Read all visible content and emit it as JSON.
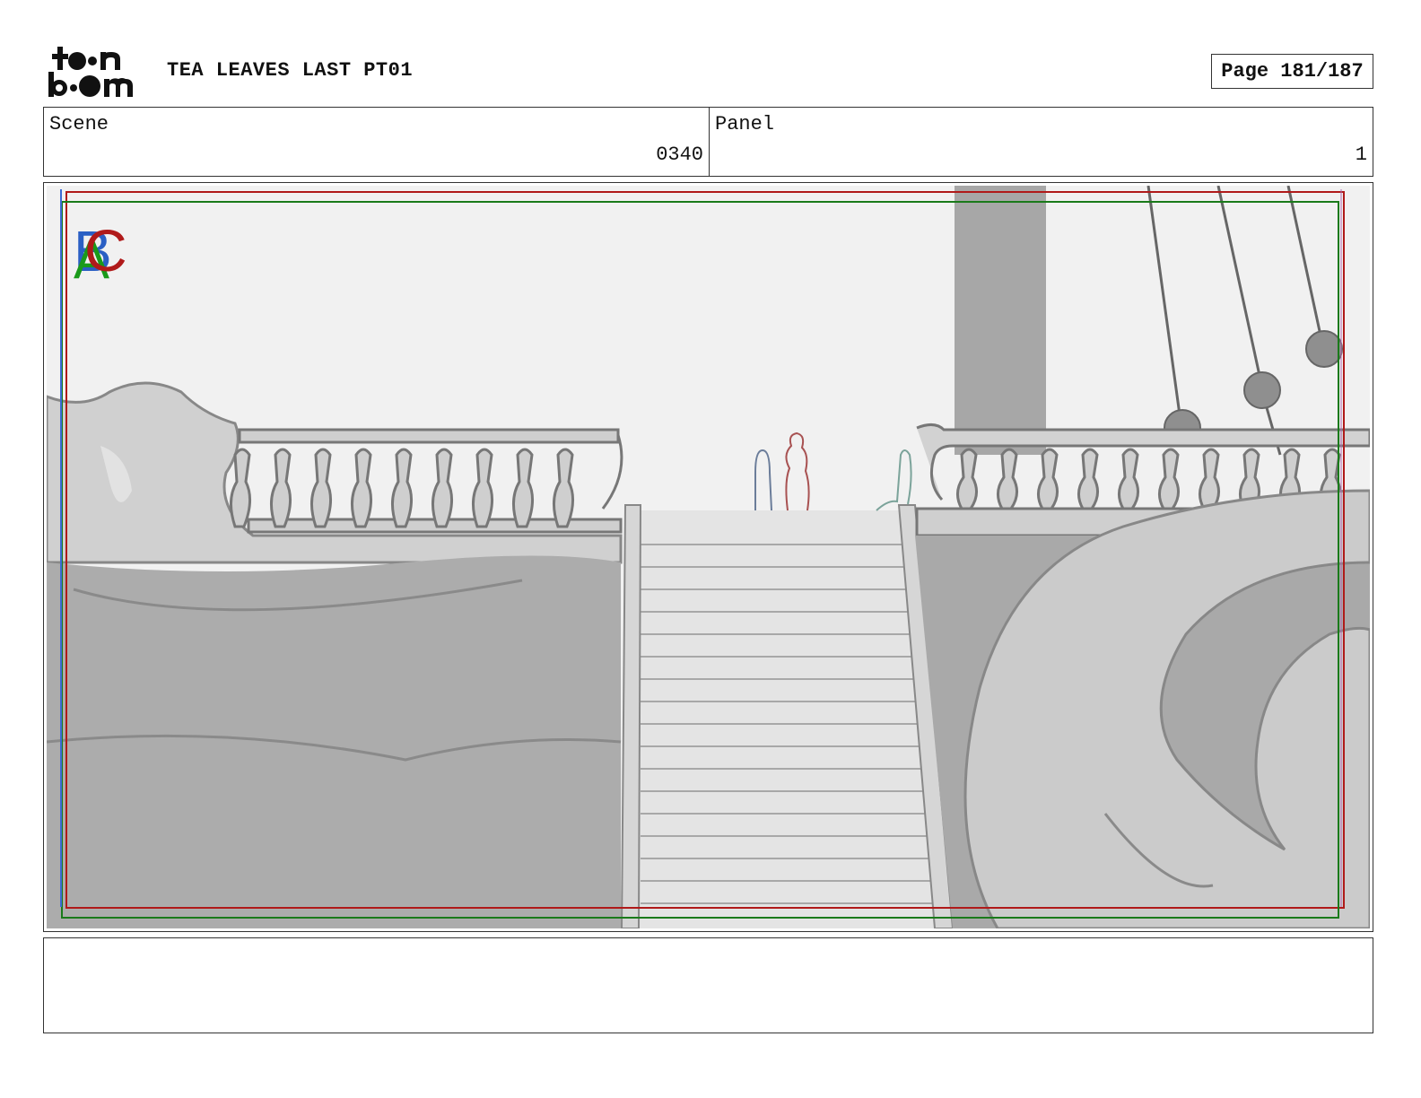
{
  "header": {
    "logo": {
      "text_line1": "toon",
      "text_line2": "boom",
      "icon": "toon-boom-logo"
    },
    "project_title": "TEA LEAVES LAST PT01",
    "page_label": "Page 181/187"
  },
  "info": {
    "scene_label": "Scene",
    "scene_value": "0340",
    "panel_label": "Panel",
    "panel_value": "1"
  },
  "frame": {
    "field_markers": [
      "B",
      "A",
      "C"
    ],
    "marker_colors": {
      "A": "#1a9a1a",
      "B": "#2a5fc4",
      "C": "#b01a1a"
    },
    "guide_colors": {
      "outer": "#b01a1a",
      "inner": "#1a7a1a",
      "side": "#3a6ad4"
    },
    "artwork": "ship-deck-staircase-sketch"
  },
  "notes": {
    "text": ""
  }
}
